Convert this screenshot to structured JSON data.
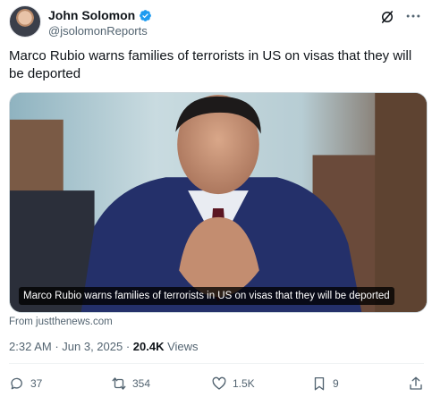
{
  "author": {
    "display_name": "John Solomon",
    "handle": "@jsolomonReports",
    "verified": true
  },
  "tweet": {
    "text": "Marco Rubio warns families of terrorists in US on visas that they will be deported"
  },
  "media": {
    "caption": "Marco Rubio warns families of terrorists in US on visas that they will be deported",
    "source": "From justthenews.com"
  },
  "meta": {
    "time": "2:32 AM",
    "separator1": " · ",
    "date": "Jun 3, 2025",
    "separator2": " · ",
    "views_count": "20.4K",
    "views_label": " Views"
  },
  "actions": {
    "replies": "37",
    "reposts": "354",
    "likes": "1.5K",
    "bookmarks": "9"
  },
  "icons": [
    "verified-badge-icon",
    "grok-icon",
    "more-icon",
    "reply-icon",
    "repost-icon",
    "like-icon",
    "bookmark-icon",
    "share-icon"
  ],
  "colors": {
    "verified_blue": "#1d9bf0",
    "secondary_text": "#536471",
    "primary_text": "#0f1419"
  }
}
